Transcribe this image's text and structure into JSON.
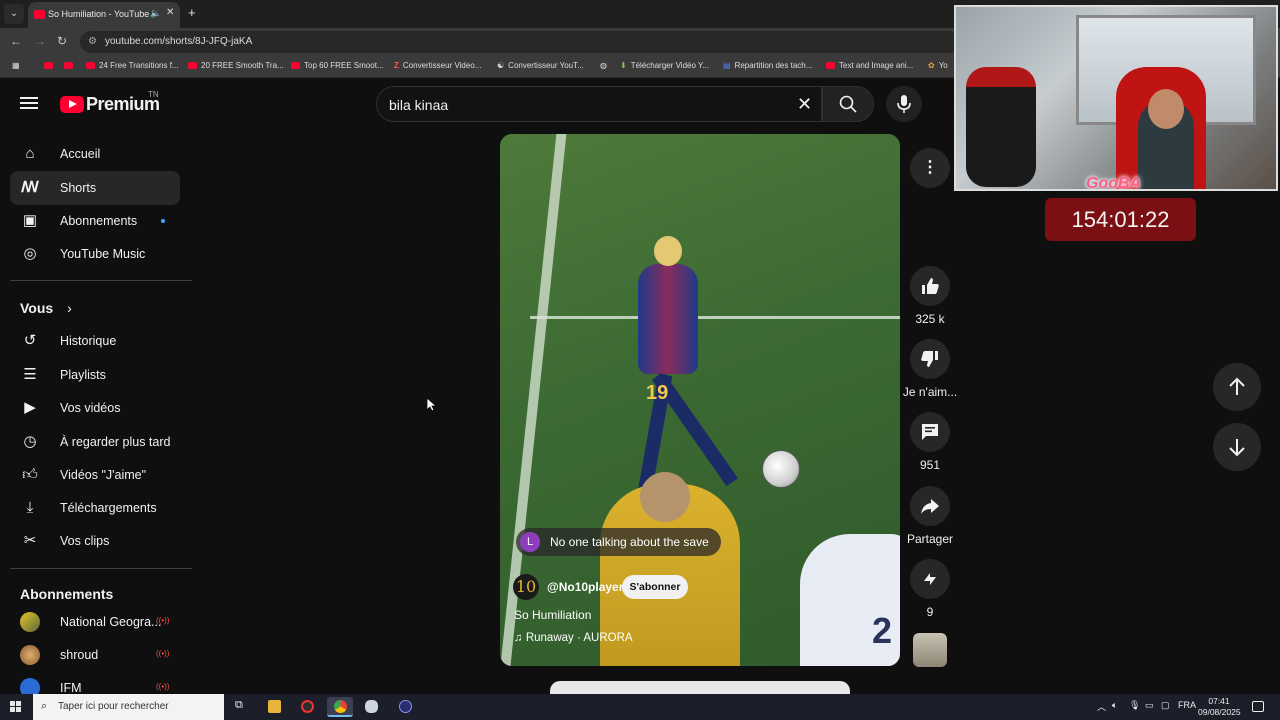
{
  "browser": {
    "tab_title": "So Humiliation - YouTube",
    "url": "youtube.com/shorts/8J-JFQ-jaKA",
    "bookmarks": [
      "24 Free Transitions f...",
      "20 FREE Smooth Tra...",
      "Top 60 FREE Smoot...",
      "Convertisseur Video...",
      "Convertisseur YouT...",
      "Télécharger Vidéo Y...",
      "Repartition des tach...",
      "Text and Image ani...",
      "Yo"
    ]
  },
  "header": {
    "logo_text": "Premium",
    "country": "TN",
    "search_value": "bila kinaa"
  },
  "sidebar": {
    "main": [
      {
        "label": "Accueil",
        "icon": "home-icon"
      },
      {
        "label": "Shorts",
        "icon": "shorts-icon"
      },
      {
        "label": "Abonnements",
        "icon": "subscriptions-icon"
      },
      {
        "label": "YouTube Music",
        "icon": "music-icon"
      }
    ],
    "you_title": "Vous",
    "you_items": [
      {
        "label": "Historique",
        "icon": "history-icon"
      },
      {
        "label": "Playlists",
        "icon": "playlists-icon"
      },
      {
        "label": "Vos vidéos",
        "icon": "your-videos-icon"
      },
      {
        "label": "À regarder plus tard",
        "icon": "watch-later-icon"
      },
      {
        "label": "Vidéos \"J'aime\"",
        "icon": "liked-icon"
      },
      {
        "label": "Téléchargements",
        "icon": "download-icon"
      },
      {
        "label": "Vos clips",
        "icon": "clips-icon"
      }
    ],
    "subs_title": "Abonnements",
    "subs": [
      {
        "label": "National Geogra...",
        "live": "((•))"
      },
      {
        "label": "shroud",
        "live": "((•))"
      },
      {
        "label": "IFM",
        "live": "((•))"
      }
    ]
  },
  "short": {
    "pinned_comment_initial": "L",
    "pinned_comment": "No one talking about the save",
    "channel_avatar_text": "10",
    "channel": "@No10player",
    "subscribe": "S'abonner",
    "title": "So Humiliation",
    "music": "Runaway · AURORA",
    "jersey_number": "19",
    "defender_number": "2"
  },
  "actions": {
    "likes": "325 k",
    "dislike": "Je n'aim...",
    "comments": "951",
    "share": "Partager",
    "remix": "9"
  },
  "overlay": {
    "webcam_logo": "GooBA",
    "timer": "154:01:22"
  },
  "taskbar": {
    "search_placeholder": "Taper ici pour rechercher",
    "lang": "FRA",
    "time": "07:41",
    "date": "09/08/2025"
  },
  "colors": {
    "youtube_red": "#ff0033",
    "timer_bg": "#7a0f14",
    "live_red": "#ff4e45"
  }
}
